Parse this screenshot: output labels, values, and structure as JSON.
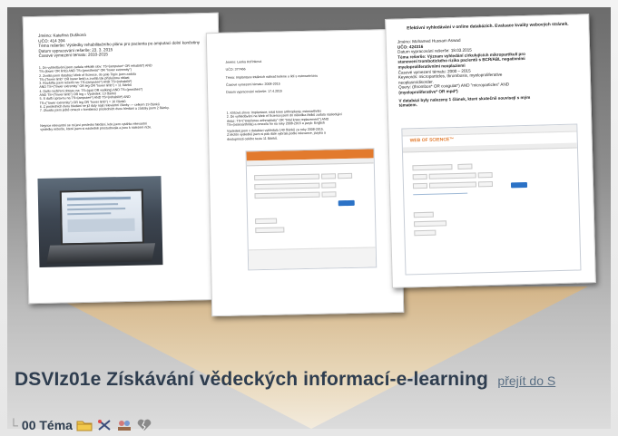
{
  "course": {
    "title": "DSVIz01e Získávání vědeckých informací-e-learning",
    "link": "přejít do S"
  },
  "topic": {
    "label": "00 Téma",
    "icons": [
      "folder-icon",
      "crossed-tools-icon",
      "group-icon",
      "broken-heart-icon"
    ]
  },
  "doc1": {
    "lines": [
      "Jméno: Kateřina Dušková",
      "UČO: 414 394",
      "Téma rešerše: Výsledky rehabilitačního plánu pro pacienta po amputaci dolní končetiny",
      "Datum vypracování rešerše: 23. 3. 2015",
      "Časové vymezení tématu: 2010-2015"
    ],
    "items": [
      "1. Do vyhledávání jsem zadala několik slov: TS=(amputee* OR rehabilit*) AND",
      "TS=(lower OR limb) AND TS=(prosthesis* OR \"lower extremity\")",
      "2. Zvolila jsem databázi Web of Science, do pole Topic jsem zadala",
      "TS=(\"lower limb\" OR lower limb) a zvolila tak příslušnou oblast",
      "3. Rozšířila jsem rešerši na: TS=(amputee*) AND TS=(rehabilit*)",
      "AND TS=(\"lower extremity\" OR leg OR \"lower limb\") = 11 článků",
      "4. Další rozšíření dotazu na: TS=(gait OR walking) AND TS=(prosthes*)",
      "AND TS=(\"lower limb\") OR leg = Výsledek: 13 článků",
      "5. S další úpravou na TS=(amputee*) AND TS=(rehabilit*) AND",
      "TS=(\"lower extremity\") OR leg OR \"lower limb\") = 16 článků",
      "6. Z posledních dvou hledání se již daly najít relevantní články — celkem 19 článků",
      "7. Zkusila jsem ještě omezit v kombinaci posledních dvou hledání a zůstaly jsem 2 články."
    ],
    "note": [
      "Nejvíce relevantní se mi jeví poslední hledání, kde jsem vytáhla relevantní",
      "výsledky rešerše, které jsem si následně prostudovala a jsou k nalezení níže."
    ]
  },
  "doc2": {
    "header": [
      "Jméno: Lenka Kořínková",
      "UČO: 377466",
      "Téma: Implantace totálních náhrad kolene u lidí s osteoartrózou",
      "Časové vymezení tématu: 2008-2015",
      "Datum vypracování rešerše: 17.4.2015"
    ],
    "steps": [
      "1. Klíčová slova: Implantace, total knee arthroplasty, osteoarthritis",
      "2. Do vyhledávání na Web of Science jsem do několika řádků zadala následující",
      "dotaz: TS=(\"total knee arthroplasty\" OR \"total knee replacement\") AND",
      "TS=(osteoarthritis) a omezila ho na roky 2008-2015 a jazyk: English",
      "Výsledek jsem v databázi vyhledala 140 článků za roky 2008-2015.",
      "Z těchto výsledků jsem si pak dále vybrala podle relevance, jazyka a",
      "dostupnosti celého textu 11 článků."
    ]
  },
  "doc3": {
    "title": "Efektivní vyhledávání v online databázích. Evaluace kvality webových stránek.",
    "lines": [
      "Jméno: Mohamed Hussam Aswad",
      "UČO: 424316",
      "Datum vypracování rešerše: 18.03.2015",
      "Téma rešerše: Význam vyhledání cirkulujících mikropartikulí pro",
      "stanovení trombotického rizika pacientů s BCR/ABL negativními",
      "myeloproliferativními neoplaziemi",
      "Časové vymezení tématu: 2000 – 2015",
      "Keywords: microparticles, thrombosis, myeloproliferative",
      "neoplasm/disorder.",
      "Query: (thrombos* OR coagulat*) AND \"microparticles\" AND",
      "(myeloproliferative* OR mpd*)"
    ],
    "found": [
      "V databázi byly nalezeny 1 článek, které skutečně souvisejí s mým",
      "tématem."
    ],
    "wos": "WEB OF SCIENCE™"
  },
  "colors": {
    "accent": "#e27a2d",
    "title": "#2e3d4f",
    "link": "#5a6f84",
    "funnel": "#e2c9a0"
  }
}
